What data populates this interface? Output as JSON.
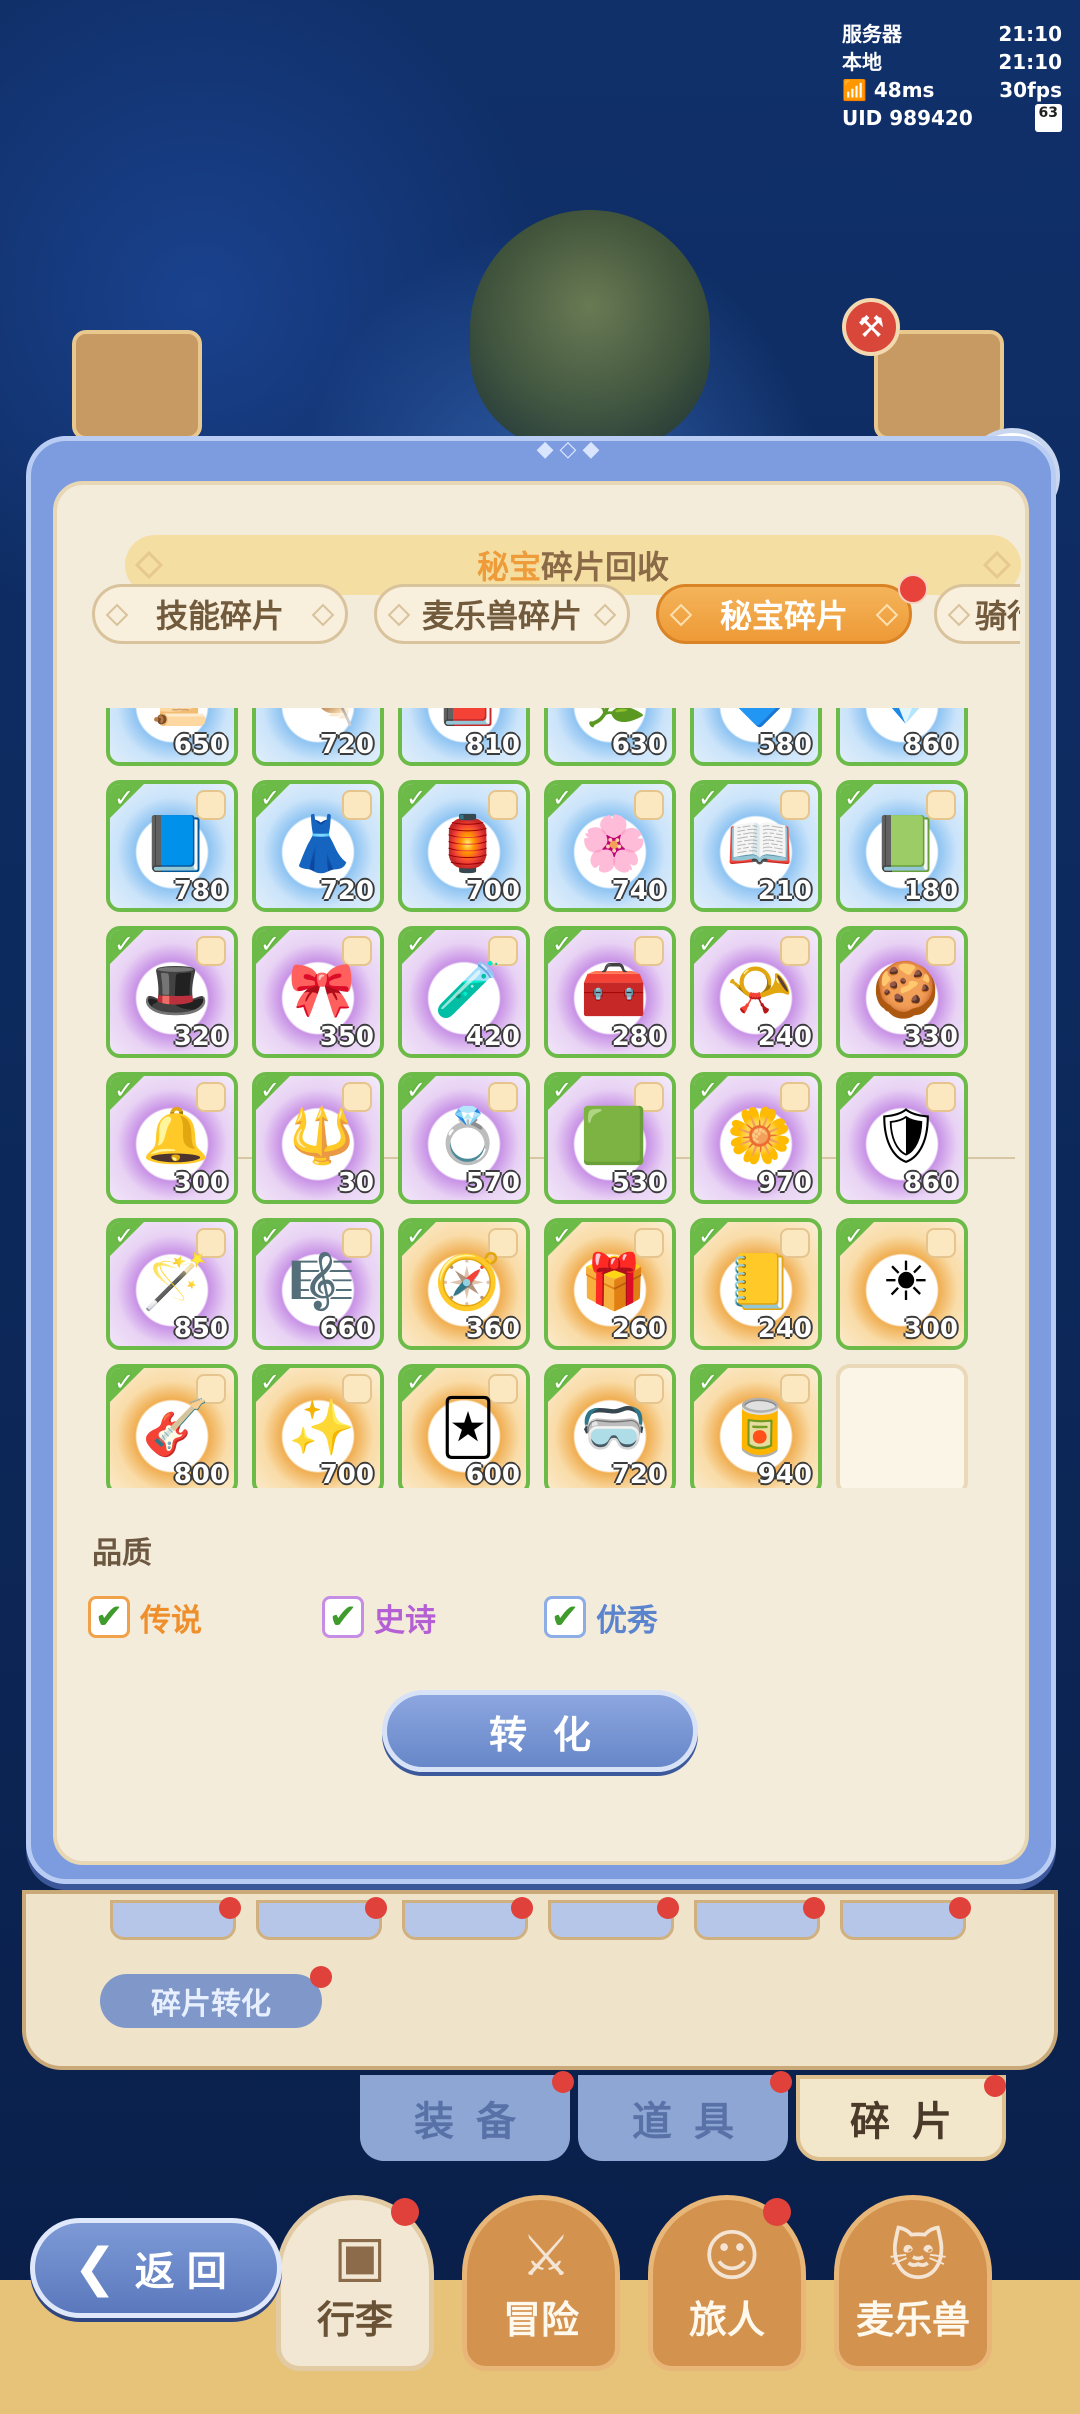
{
  "hud": {
    "server_label": "服务器",
    "server_time": "21:10",
    "local_label": "本地",
    "local_time": "21:10",
    "ping": "48ms",
    "fps": "30fps",
    "uid_label": "UID",
    "uid": "989420",
    "battery": "63"
  },
  "dialog": {
    "title_highlight": "秘宝",
    "title_rest": "碎片回收",
    "tabs": [
      {
        "label": "技能碎片",
        "active": false
      },
      {
        "label": "麦乐兽碎片",
        "active": false
      },
      {
        "label": "秘宝碎片",
        "active": true
      },
      {
        "label": "骑行",
        "active": false
      }
    ],
    "items": [
      {
        "rarity": "blue",
        "count": "650",
        "icon": "scroll-icon"
      },
      {
        "rarity": "blue",
        "count": "720",
        "icon": "feather-icon"
      },
      {
        "rarity": "blue",
        "count": "810",
        "icon": "book-icon"
      },
      {
        "rarity": "blue",
        "count": "630",
        "icon": "plant-icon"
      },
      {
        "rarity": "blue",
        "count": "580",
        "icon": "crystal-icon"
      },
      {
        "rarity": "blue",
        "count": "860",
        "icon": "gem-icon"
      },
      {
        "rarity": "blue",
        "count": "780",
        "icon": "tome-icon"
      },
      {
        "rarity": "blue",
        "count": "720",
        "icon": "dress-icon"
      },
      {
        "rarity": "blue",
        "count": "700",
        "icon": "lantern-icon"
      },
      {
        "rarity": "blue",
        "count": "740",
        "icon": "flower-icon"
      },
      {
        "rarity": "blue",
        "count": "210",
        "icon": "spellbook-icon"
      },
      {
        "rarity": "blue",
        "count": "180",
        "icon": "tablet-icon"
      },
      {
        "rarity": "purple",
        "count": "320",
        "icon": "witch-hat-icon"
      },
      {
        "rarity": "purple",
        "count": "350",
        "icon": "ribbon-icon"
      },
      {
        "rarity": "purple",
        "count": "420",
        "icon": "potion-icon"
      },
      {
        "rarity": "purple",
        "count": "280",
        "icon": "treasure-chest-icon"
      },
      {
        "rarity": "purple",
        "count": "240",
        "icon": "horn-icon"
      },
      {
        "rarity": "purple",
        "count": "330",
        "icon": "plate-icon"
      },
      {
        "rarity": "purple",
        "count": "300",
        "icon": "bell-icon"
      },
      {
        "rarity": "purple",
        "count": "30",
        "icon": "trident-icon"
      },
      {
        "rarity": "purple",
        "count": "570",
        "icon": "ring-icon"
      },
      {
        "rarity": "purple",
        "count": "530",
        "icon": "emerald-icon"
      },
      {
        "rarity": "purple",
        "count": "970",
        "icon": "wreath-icon"
      },
      {
        "rarity": "purple",
        "count": "860",
        "icon": "armor-icon"
      },
      {
        "rarity": "purple",
        "count": "850",
        "icon": "wand-icon"
      },
      {
        "rarity": "purple",
        "count": "660",
        "icon": "harp-icon"
      },
      {
        "rarity": "orange",
        "count": "360",
        "icon": "compass-icon"
      },
      {
        "rarity": "orange",
        "count": "260",
        "icon": "gift-box-icon"
      },
      {
        "rarity": "orange",
        "count": "240",
        "icon": "ledger-icon"
      },
      {
        "rarity": "orange",
        "count": "300",
        "icon": "sun-medallion-icon"
      },
      {
        "rarity": "orange",
        "count": "800",
        "icon": "guitar-icon"
      },
      {
        "rarity": "orange",
        "count": "700",
        "icon": "sparkle-icon"
      },
      {
        "rarity": "orange",
        "count": "600",
        "icon": "card-icon"
      },
      {
        "rarity": "orange",
        "count": "720",
        "icon": "goggles-icon"
      },
      {
        "rarity": "orange",
        "count": "940",
        "icon": "jar-icon"
      },
      {
        "rarity": "empty",
        "count": "",
        "icon": ""
      }
    ],
    "quality_label": "品质",
    "filters": {
      "legend": "传说",
      "epic": "史诗",
      "fine": "优秀"
    },
    "filter_checked": {
      "legend": true,
      "epic": true,
      "fine": true
    },
    "convert_label": "转化"
  },
  "background": {
    "convert_chip": "碎片转化",
    "category_tabs": [
      "装备",
      "道具",
      "碎片"
    ]
  },
  "nav": {
    "back_label": "返回",
    "items": [
      "行李",
      "冒险",
      "旅人",
      "麦乐兽"
    ]
  },
  "colors": {
    "legend": "#ee8f2c",
    "epic": "#b55fd5",
    "fine": "#5b84cf",
    "accent_tab": "#ee9a36",
    "selected_border": "#6cbb48"
  }
}
